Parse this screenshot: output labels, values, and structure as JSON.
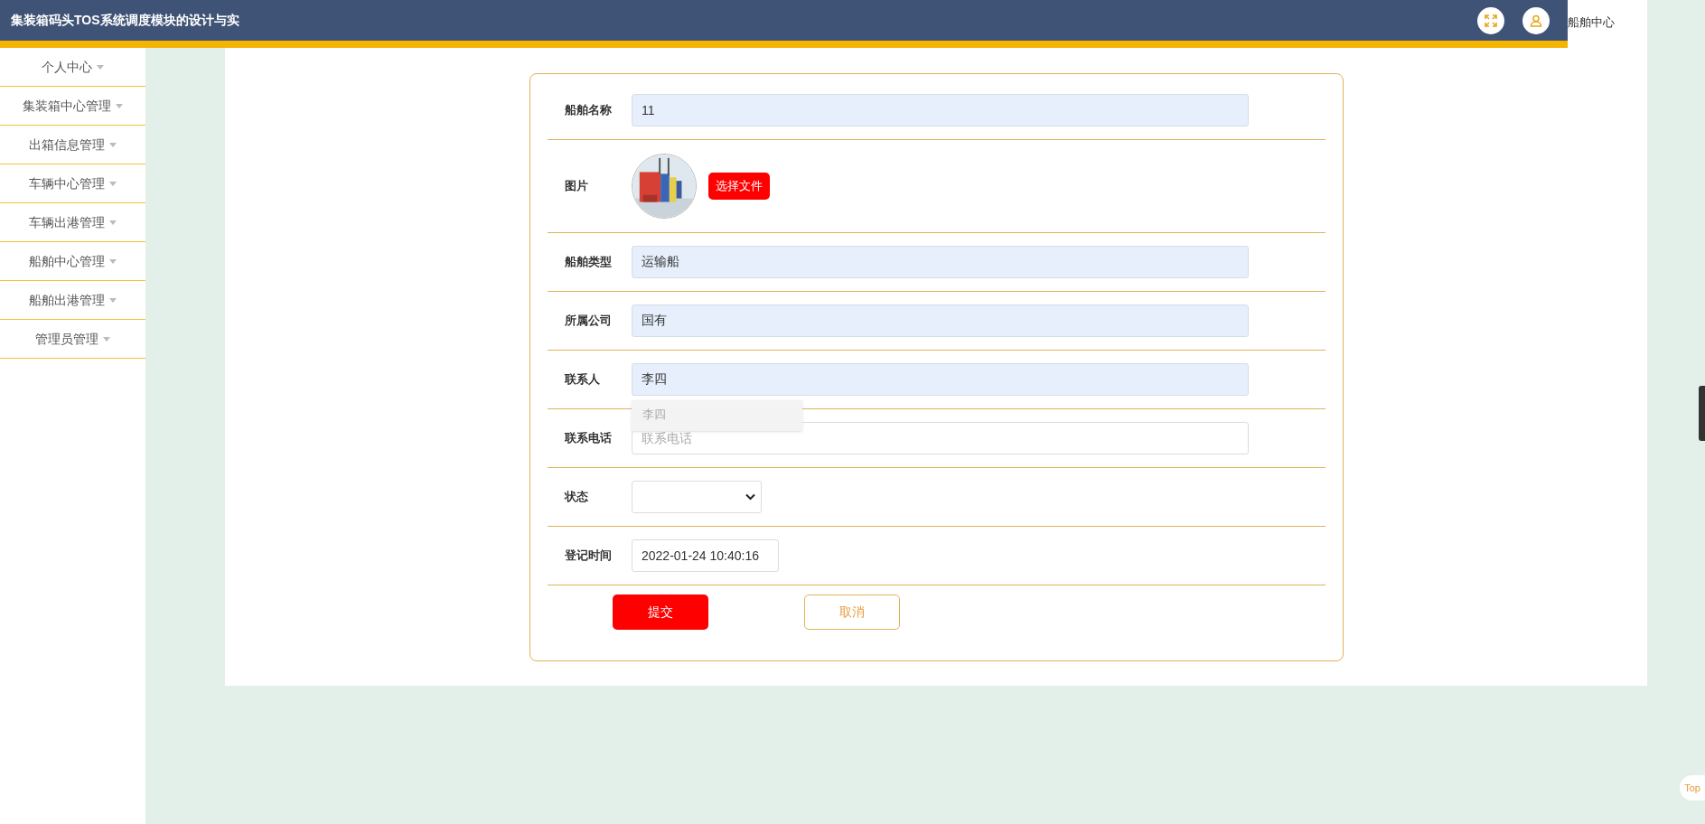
{
  "header": {
    "title": "集装箱码头TOS系统调度模块的设计与实",
    "user_label": "船舶中心"
  },
  "sidebar": {
    "items": [
      {
        "label": "个人中心"
      },
      {
        "label": "集装箱中心管理"
      },
      {
        "label": "出箱信息管理"
      },
      {
        "label": "车辆中心管理"
      },
      {
        "label": "车辆出港管理"
      },
      {
        "label": "船舶中心管理"
      },
      {
        "label": "船舶出港管理"
      },
      {
        "label": "管理员管理"
      }
    ]
  },
  "form": {
    "fields": [
      {
        "kind": "text",
        "label": "船舶名称",
        "value": "11",
        "autofilled": true
      },
      {
        "label": "图片",
        "button": "选择文件"
      },
      {
        "kind": "text",
        "label": "船舶类型",
        "value": "运输船",
        "autofilled": true
      },
      {
        "kind": "text",
        "label": "所属公司",
        "value": "国有",
        "autofilled": true
      },
      {
        "kind": "text",
        "label": "联系人",
        "value": "李四",
        "autofilled": true,
        "suggestion": "李四"
      },
      {
        "kind": "text",
        "label": "联系电话",
        "placeholder": "联系电话",
        "autofilled": false
      },
      {
        "kind": "select",
        "label": "状态"
      },
      {
        "kind": "date",
        "label": "登记时间",
        "value": "2022-01-24 10:40:16",
        "autofilled": false
      }
    ],
    "buttons": [
      {
        "kind": "primary",
        "label": "提交"
      },
      {
        "kind": "outline",
        "label": "取消"
      }
    ]
  },
  "top_button": "Top"
}
